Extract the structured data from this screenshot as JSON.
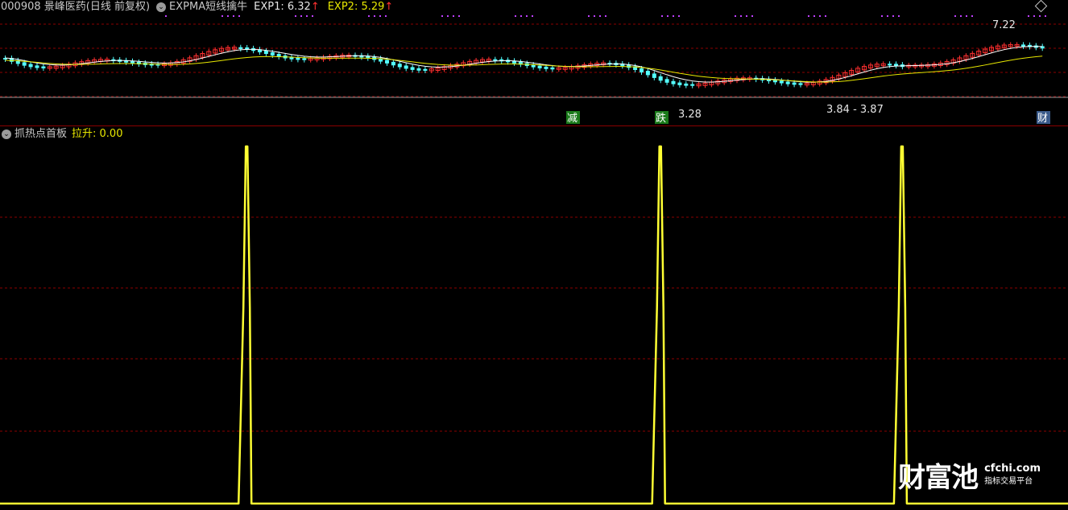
{
  "header": {
    "stock": "000908 景峰医药(日线 前复权)",
    "indicator": "EXPMA短线擒牛",
    "exp1_label": "EXP1: 6.32",
    "exp2_label": "EXP2: 5.29",
    "arrow": "↑",
    "dropdown_icon": "chevron-down-icon"
  },
  "sub_header": {
    "indicator": "抓热点首板",
    "value_label": "拉升: 0.00"
  },
  "colors": {
    "background": "#000000",
    "up": "#ff3030",
    "down": "#54ffff",
    "exp1": "#ffffff",
    "exp2": "#e8e800",
    "spike": "#ffff33",
    "separator": "#8b0000",
    "grid": "#8b0000"
  },
  "chart_data": [
    {
      "type": "candlestick",
      "title": "000908 景峰医药(日线 前复权)",
      "annotations": {
        "high_label": "7.22",
        "low_label": "3.28",
        "range_label": "3.84 - 3.87",
        "markers": [
          "减",
          "跌",
          "财"
        ]
      },
      "series": [
        {
          "name": "EXP1",
          "last": 6.32
        },
        {
          "name": "EXP2",
          "last": 5.29
        }
      ]
    },
    {
      "type": "line",
      "title": "抓热点首板",
      "series": [
        {
          "name": "拉升",
          "last": 0.0
        }
      ],
      "spikes": [
        {
          "bar_index": 38,
          "value": 1
        },
        {
          "bar_index": 103,
          "value": 1
        },
        {
          "bar_index": 141,
          "value": 1
        }
      ],
      "bar_count": 164,
      "ylim": [
        0,
        1
      ]
    }
  ],
  "watermark": {
    "big": "财富池",
    "site": "cfchi.com",
    "tagline": "指标交易平台"
  }
}
